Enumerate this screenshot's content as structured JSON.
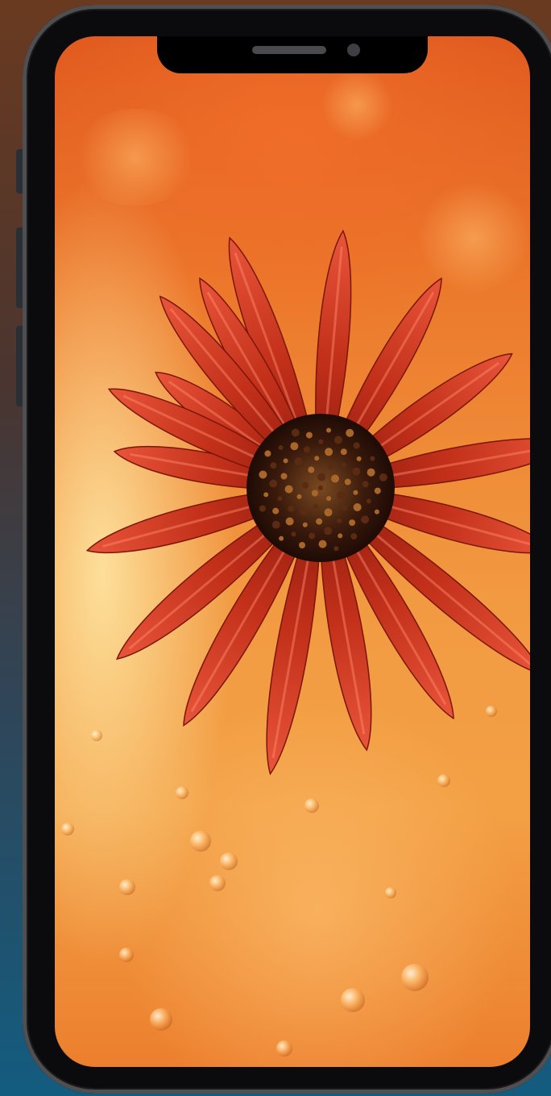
{
  "device": {
    "frame_color": "#0b0b0d",
    "bezel_color": "#4f4f52",
    "background_top_color": "#6a3a20",
    "background_bottom_color": "#135c80"
  },
  "wallpaper": {
    "subject": "red-daisy-flower",
    "petal_color": "#c3301a",
    "petal_highlight_color": "#e8553a",
    "center_color": "#3a1a0c",
    "background_color": "#ec7a2c"
  },
  "icons": {
    "speaker": "speaker-grille-icon",
    "camera": "front-camera-icon"
  }
}
